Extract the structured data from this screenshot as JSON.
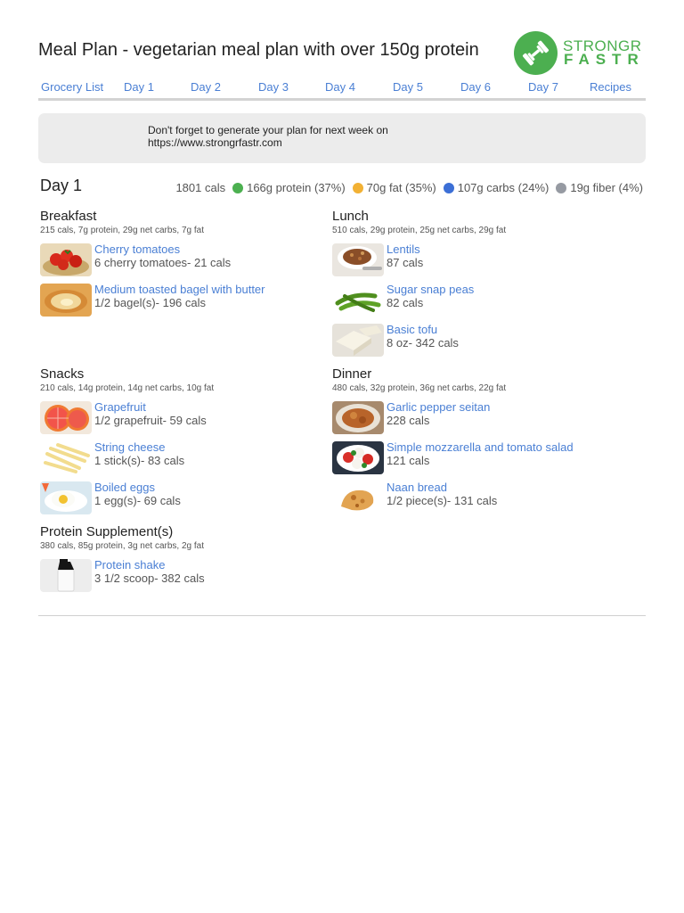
{
  "title": "Meal Plan - vegetarian meal plan with over 150g protein",
  "logo": {
    "line1": "STRONGR",
    "line2": "FASTR",
    "color": "#4caf50"
  },
  "nav": {
    "items": [
      "Grocery List",
      "Day 1",
      "Day 2",
      "Day 3",
      "Day 4",
      "Day 5",
      "Day 6",
      "Day 7",
      "Recipes"
    ],
    "link_color": "#4a7fd4"
  },
  "notice": {
    "line1": "Don't forget to generate your plan for next week on",
    "line2": "https://www.strongrfastr.com"
  },
  "day": {
    "title": "Day 1",
    "calories": "1801 cals",
    "protein": "166g protein (37%)",
    "fat": "70g fat (35%)",
    "carbs": "107g carbs (24%)",
    "fiber": "19g fiber (4%)",
    "colors": {
      "protein": "#4cb050",
      "fat": "#f2b134",
      "carbs": "#3c6fd6",
      "fiber": "#969aa2"
    }
  },
  "meals": {
    "breakfast": {
      "name": "Breakfast",
      "info": "215 cals, 7g protein, 29g net carbs, 7g fat",
      "items": [
        {
          "name": "Cherry tomatoes",
          "amount": "6 cherry tomatoes- 21 cals",
          "icon": "cherry-tomatoes-icon"
        },
        {
          "name": "Medium toasted bagel with butter",
          "amount": "1/2 bagel(s)- 196 cals",
          "icon": "bagel-icon"
        }
      ]
    },
    "lunch": {
      "name": "Lunch",
      "info": "510 cals, 29g protein, 25g net carbs, 29g fat",
      "items": [
        {
          "name": "Lentils",
          "amount": "87 cals",
          "icon": "lentils-icon"
        },
        {
          "name": "Sugar snap peas",
          "amount": "82 cals",
          "icon": "snap-peas-icon"
        },
        {
          "name": "Basic tofu",
          "amount": "8 oz- 342 cals",
          "icon": "tofu-icon"
        }
      ]
    },
    "snacks": {
      "name": "Snacks",
      "info": "210 cals, 14g protein, 14g net carbs, 10g fat",
      "items": [
        {
          "name": "Grapefruit",
          "amount": "1/2 grapefruit- 59 cals",
          "icon": "grapefruit-icon"
        },
        {
          "name": "String cheese",
          "amount": "1 stick(s)- 83 cals",
          "icon": "string-cheese-icon"
        },
        {
          "name": "Boiled eggs",
          "amount": "1 egg(s)- 69 cals",
          "icon": "boiled-egg-icon"
        }
      ]
    },
    "dinner": {
      "name": "Dinner",
      "info": "480 cals, 32g protein, 36g net carbs, 22g fat",
      "items": [
        {
          "name": "Garlic pepper seitan",
          "amount": "228 cals",
          "icon": "seitan-icon"
        },
        {
          "name": "Simple mozzarella and tomato salad",
          "amount": "121 cals",
          "icon": "caprese-salad-icon"
        },
        {
          "name": "Naan bread",
          "amount": "1/2 piece(s)- 131 cals",
          "icon": "naan-bread-icon"
        }
      ]
    },
    "supplement": {
      "name": "Protein Supplement(s)",
      "info": "380 cals, 85g protein, 3g net carbs, 2g fat",
      "items": [
        {
          "name": "Protein shake",
          "amount": "3 1/2 scoop- 382 cals",
          "icon": "protein-shaker-icon"
        }
      ]
    }
  }
}
